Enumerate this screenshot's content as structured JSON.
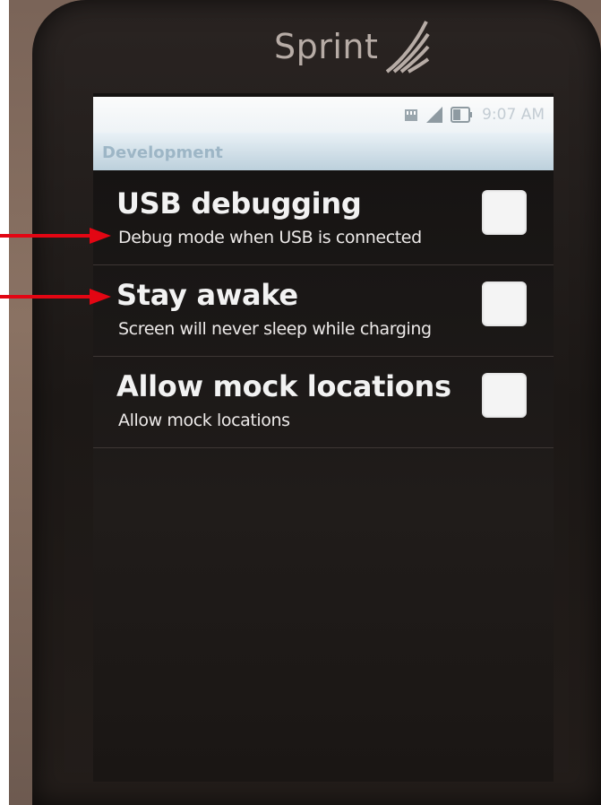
{
  "device": {
    "carrier": "Sprint"
  },
  "status_bar": {
    "time": "9:07 AM",
    "icons": [
      "sd-card-icon",
      "signal-icon",
      "battery-icon"
    ]
  },
  "title_bar": {
    "title": "Development"
  },
  "preferences": [
    {
      "title": "USB debugging",
      "summary": "Debug mode when USB is connected",
      "checked": false
    },
    {
      "title": "Stay awake",
      "summary": "Screen will never sleep while charging",
      "checked": false
    },
    {
      "title": "Allow mock locations",
      "summary": "Allow mock locations",
      "checked": false
    }
  ],
  "colors": {
    "annotation_arrow": "#e30613",
    "checkbox": "#f4f4f4",
    "screen_background": "#1a1716"
  }
}
